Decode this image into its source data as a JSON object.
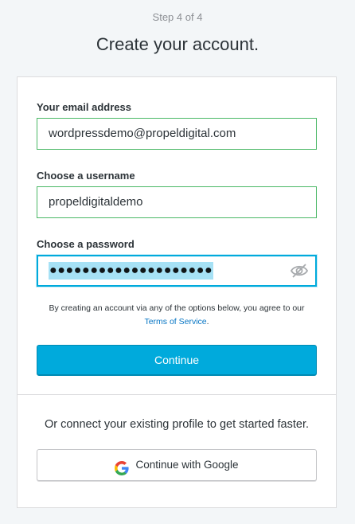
{
  "header": {
    "step": "Step 4 of 4",
    "title": "Create your account."
  },
  "form": {
    "email_label": "Your email address",
    "email_value": "wordpressdemo@propeldigital.com",
    "username_label": "Choose a username",
    "username_value": "propeldigitaldemo",
    "password_label": "Choose a password",
    "password_masked": "●●●●●●●●●●●●●●●●●●●●",
    "toggle_icon": "eye-slash-icon"
  },
  "terms": {
    "prefix": "By creating an account via any of the options below, you agree to our",
    "link": "Terms of Service",
    "suffix": "."
  },
  "continue_label": "Continue",
  "social": {
    "connect_text": "Or connect your existing profile to get started faster.",
    "google_label": "Continue with Google",
    "google_icon": "google-logo-icon"
  },
  "colors": {
    "accent": "#00aadc",
    "valid_border": "#4ab866",
    "link": "#0675c4"
  }
}
